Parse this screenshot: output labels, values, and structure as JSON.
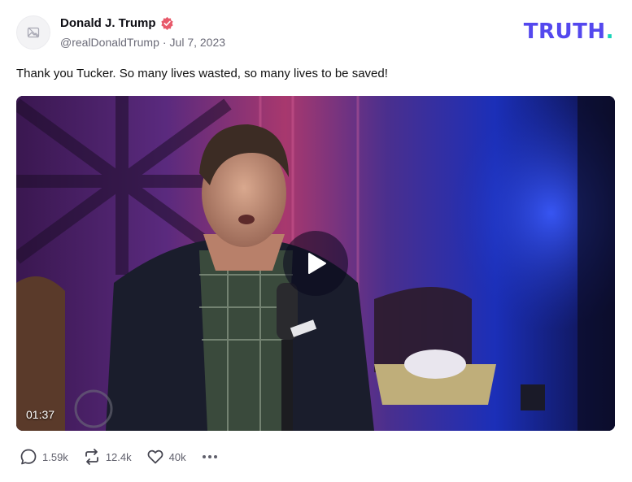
{
  "post": {
    "author_name": "Donald J. Trump",
    "handle": "@realDonaldTrump",
    "separator": "·",
    "date": "Jul 7, 2023",
    "text": "Thank you Tucker. So many lives wasted, so many lives to be saved!",
    "verified_icon": "verified-badge-icon"
  },
  "brand": {
    "logo_text": "TRUTH",
    "logo_dot": ".",
    "colors": {
      "primary": "#5448ee",
      "accent": "#17d4b8",
      "verified": "#e8596a"
    }
  },
  "video": {
    "duration": "01:37",
    "play_icon": "play-icon"
  },
  "actions": {
    "replies": "1.59k",
    "retruths": "12.4k",
    "likes": "40k",
    "icons": [
      "reply-icon",
      "retruth-icon",
      "like-icon",
      "more-icon"
    ]
  }
}
